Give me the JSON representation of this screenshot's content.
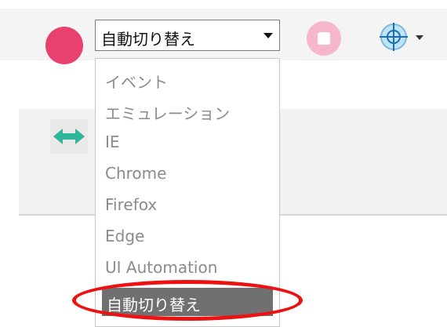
{
  "toolbar": {
    "record_icon": "record-icon",
    "mode_select": {
      "value": "自動切り替え"
    },
    "stop_icon": "stop-icon",
    "target_icon": "crosshair-target-icon"
  },
  "dropdown": {
    "options": [
      "イベント",
      "エミュレーション",
      "IE",
      "Chrome",
      "Firefox",
      "Edge",
      "UI Automation",
      "自動切り替え"
    ],
    "selected_index": 7
  },
  "colors": {
    "record": "#e8406f",
    "stop": "#f6b7cb",
    "selected_bg": "#707070",
    "highlight": "#ee1111",
    "swap_icon": "#2fb59a"
  },
  "icons": {
    "swap": "swap-arrows-icon"
  }
}
